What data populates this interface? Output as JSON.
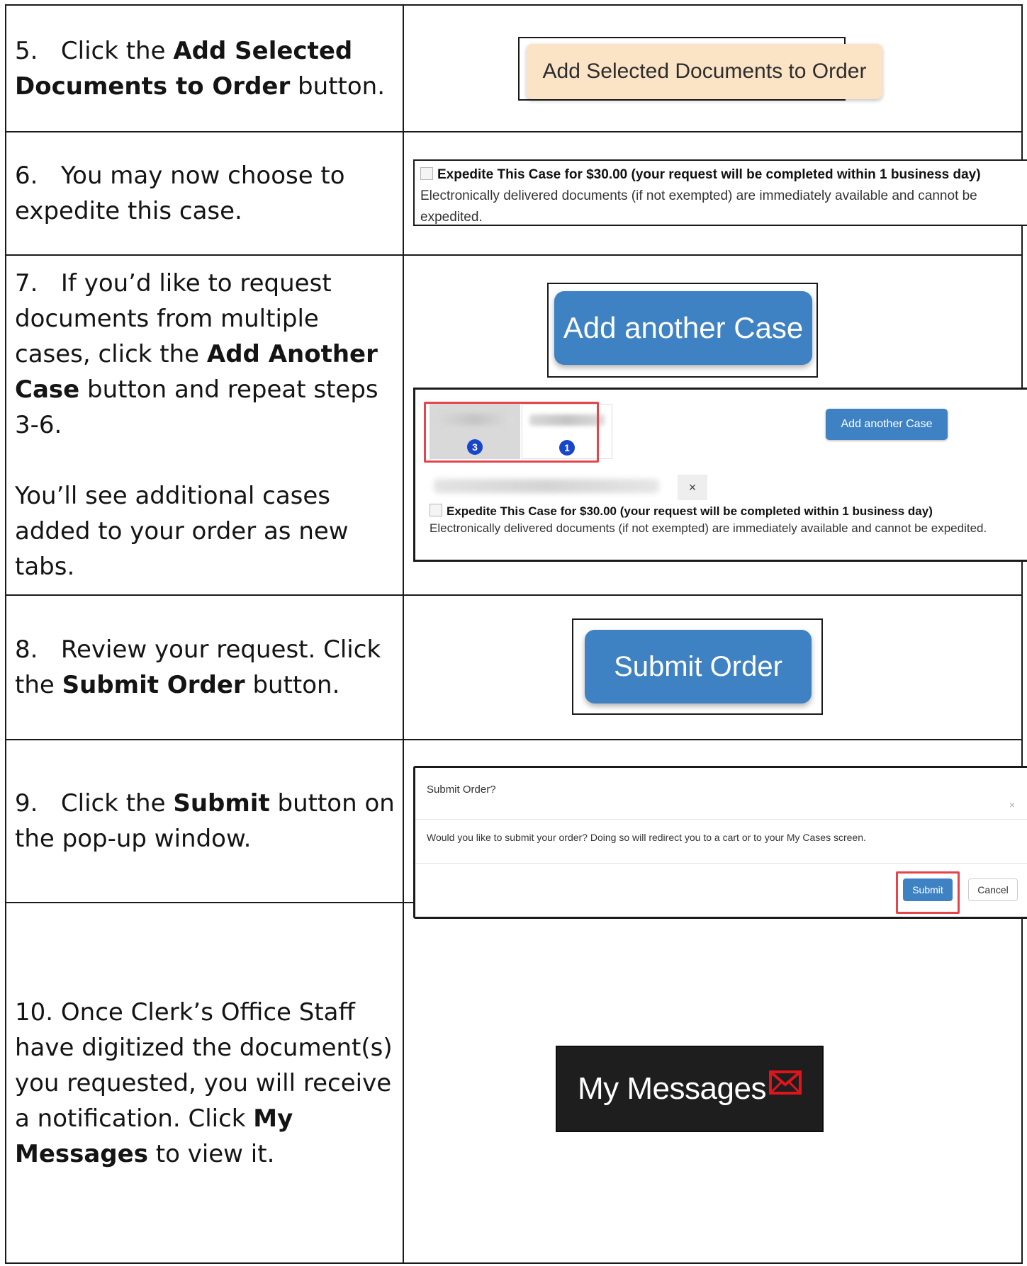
{
  "steps": [
    {
      "num": "5.",
      "pre": "Click the ",
      "bold": "Add Selected Documents to Order",
      "post": " button.",
      "button_label": "Add Selected Documents to Order"
    },
    {
      "num": "6.",
      "text": "You may now choose to expedite this case.",
      "expedite_label": "Expedite This Case for $30.00 (your request will be completed within 1 business day)",
      "expedite_note": "Electronically delivered documents (if not exempted) are immediately available and cannot be expedited."
    },
    {
      "num": "7.",
      "pre": "If you’d like to request documents from multiple cases, click the ",
      "bold": "Add Another Case",
      "post": " button and repeat steps 3-6.",
      "para2": "You’ll see additional cases added to your order as new tabs.",
      "button_label": "Add another Case",
      "small_button_label": "Add another Case",
      "tab1_badge": "3",
      "tab2_badge": "1",
      "close_symbol": "×",
      "expedite_label": "Expedite This Case for $30.00 (your request will be completed within 1 business day)",
      "expedite_note": "Electronically delivered documents (if not exempted) are immediately available and cannot be expedited."
    },
    {
      "num": "8.",
      "pre": "Review your request. Click the ",
      "bold": "Submit Order",
      "post": " button.",
      "button_label": "Submit Order"
    },
    {
      "num": "9.",
      "pre": "Click the ",
      "bold": "Submit",
      "post": " button on the pop-up window.",
      "modal_title": "Submit Order?",
      "modal_close": "×",
      "modal_body": "Would you like to submit your order? Doing so will redirect you to a cart or to your My Cases screen.",
      "submit_label": "Submit",
      "cancel_label": "Cancel"
    },
    {
      "num": "10.",
      "pre": "Once Clerk’s Office Staff have digitized the document(s) you requested, you will receive a notification. Click ",
      "bold": "My Messages",
      "post": " to view it.",
      "button_label": "My Messages",
      "icon": "envelope-icon"
    }
  ],
  "colors": {
    "blue_button": "#3e82c4",
    "peach_button": "#fbe3c6",
    "highlight_red": "#e3454a",
    "badge_blue": "#1846c9",
    "dark_bg": "#1e1e1e",
    "envelope_red": "#e0141c"
  }
}
